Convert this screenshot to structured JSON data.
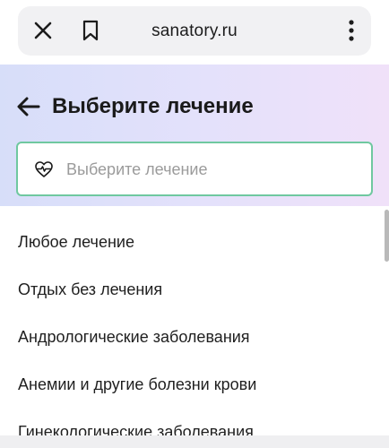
{
  "browser": {
    "url": "sanatory.ru",
    "icons": [
      "close-icon",
      "bookmark-icon",
      "more-vertical-icon"
    ]
  },
  "header": {
    "title": "Выберите лечение",
    "back_icon": "arrow-left-icon"
  },
  "search": {
    "placeholder": "Выберите лечение",
    "value": "",
    "icon": "heart-pulse-icon",
    "border_color": "#6fc8a0"
  },
  "treatments": [
    "Любое лечение",
    "Отдых без лечения",
    "Андрологические заболевания",
    "Анемии и другие болезни крови",
    "Гинекологические заболевания"
  ],
  "colors": {
    "header_gradient_start": "#d7def9",
    "header_gradient_end": "#f0e1f9",
    "text": "#1a1a1a",
    "placeholder": "#9b9b9b"
  }
}
